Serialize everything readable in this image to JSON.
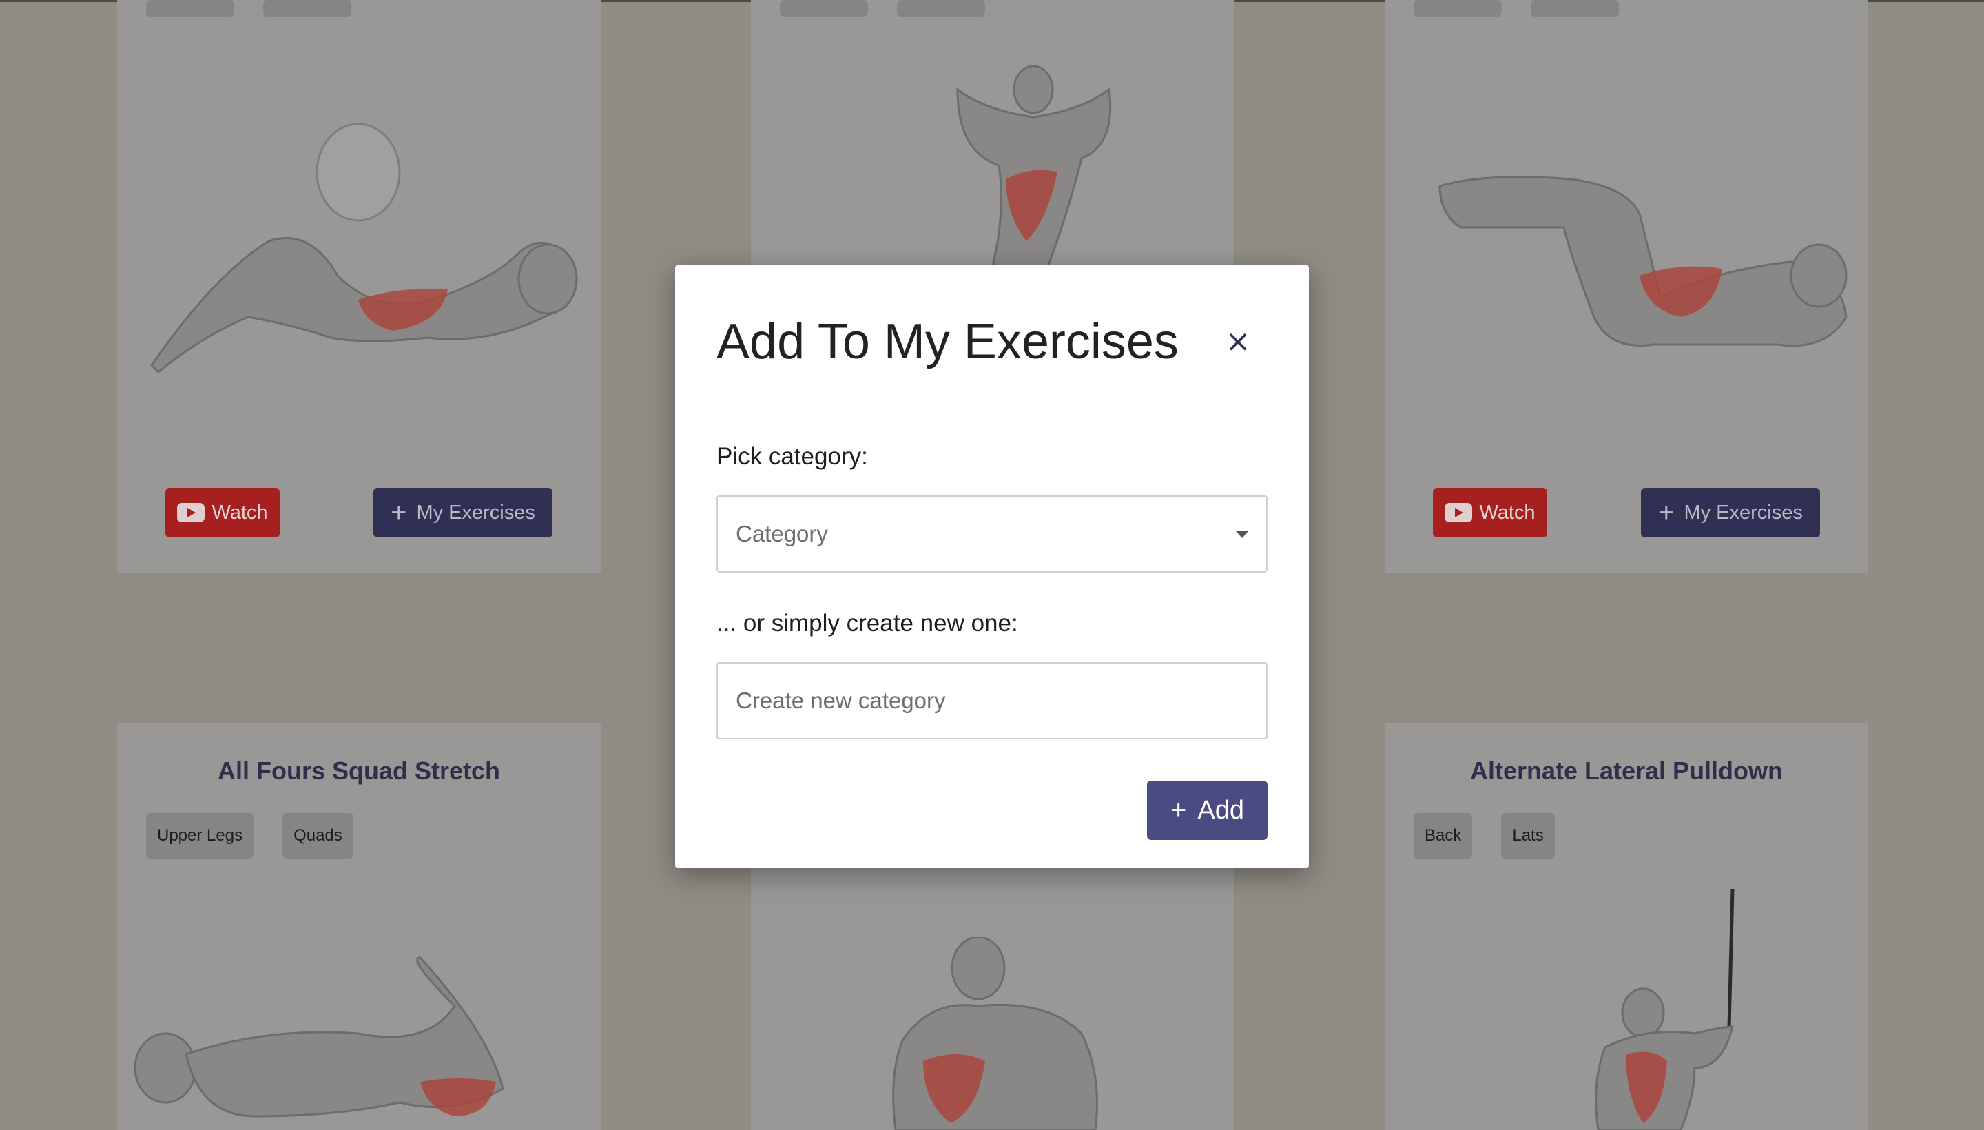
{
  "cards": [
    {
      "title": "",
      "tags": [],
      "watch_label": "Watch",
      "my_exercises_label": "My Exercises"
    },
    {
      "title": "",
      "tags": []
    },
    {
      "title": "",
      "tags": [],
      "watch_label": "Watch",
      "my_exercises_label": "My Exercises"
    },
    {
      "title": "All Fours Squad Stretch",
      "tags": [
        "Upper Legs",
        "Quads"
      ]
    },
    {
      "title": "",
      "tags": []
    },
    {
      "title": "Alternate Lateral Pulldown",
      "tags": [
        "Back",
        "Lats"
      ]
    }
  ],
  "modal": {
    "title": "Add To My Exercises",
    "close_icon": "×",
    "pick_label": "Pick category:",
    "category_placeholder": "Category",
    "create_label": "... or simply create new one:",
    "create_placeholder": "Create new category",
    "add_label": "Add"
  },
  "colors": {
    "overlay_bg": "#8f8c84",
    "watch_red": "#a5201f",
    "navy_button": "#2f3053",
    "add_button": "#4a4b80",
    "muscle_red": "#c0392b"
  }
}
